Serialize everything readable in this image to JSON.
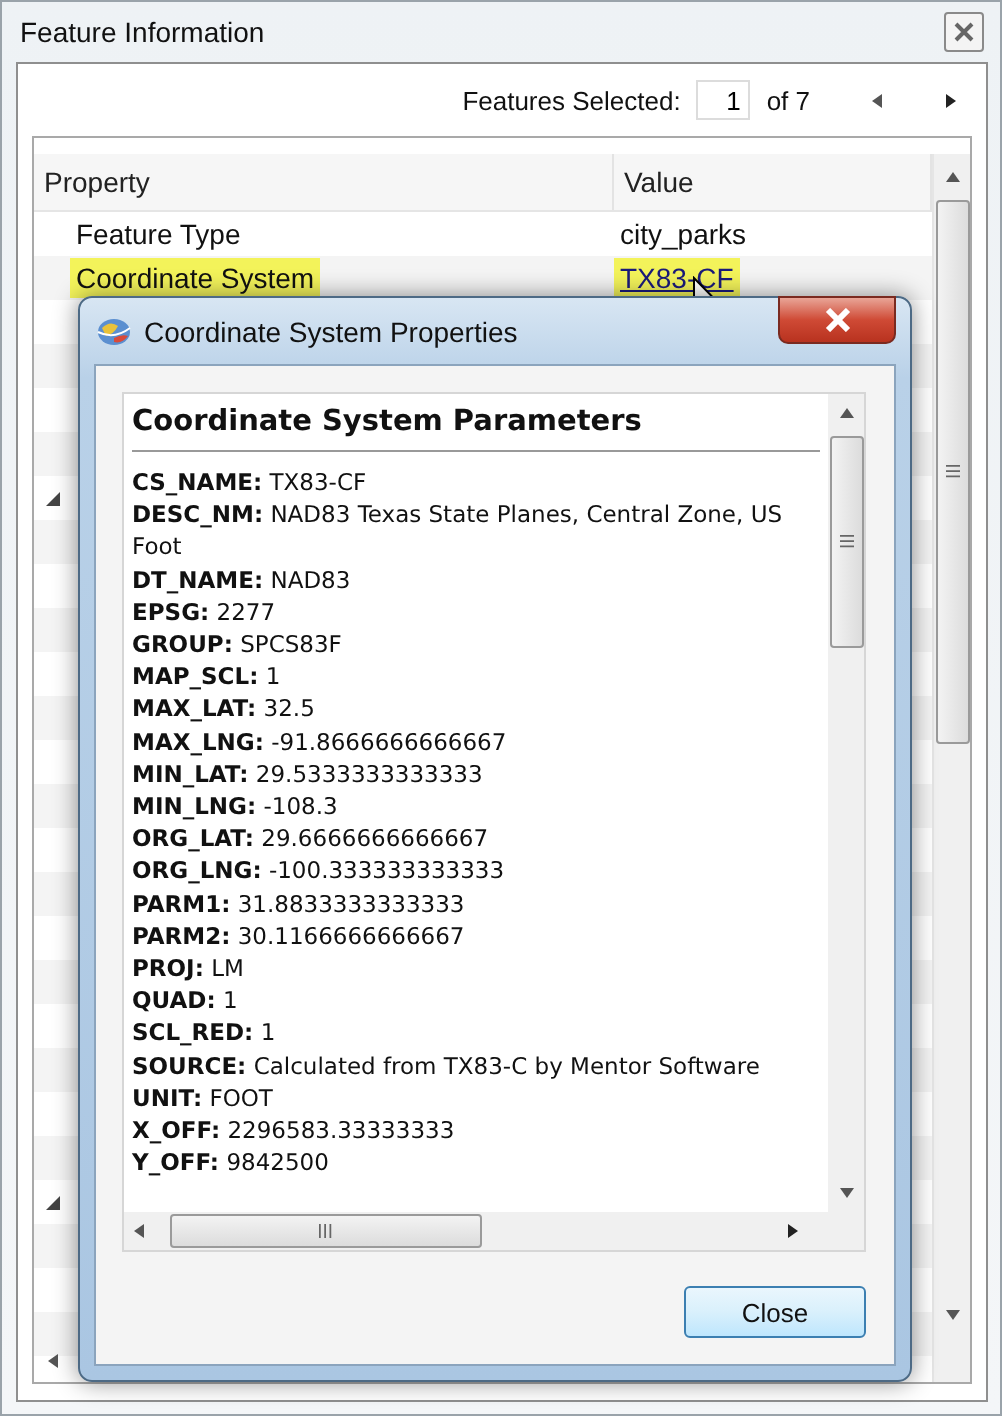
{
  "window": {
    "title": "Feature Information"
  },
  "toolbar": {
    "label": "Features Selected:",
    "value": "1",
    "total": "of 7"
  },
  "table": {
    "columns": [
      "Property",
      "Value"
    ],
    "rows": [
      {
        "property": "Feature Type",
        "value": "city_parks",
        "kind": "text",
        "selected": false
      },
      {
        "property": "Coordinate System",
        "value": "TX83-CF",
        "kind": "link",
        "selected": true
      }
    ],
    "groups": [
      {
        "expanded": true
      },
      {
        "expanded": true
      }
    ]
  },
  "dialog": {
    "title": "Coordinate System Properties",
    "heading": "Coordinate System Parameters",
    "params": [
      {
        "key": "CS_NAME:",
        "value": "TX83-CF"
      },
      {
        "key": "DESC_NM:",
        "value": "NAD83 Texas State Planes, Central Zone, US Foot"
      },
      {
        "key": "DT_NAME:",
        "value": "NAD83"
      },
      {
        "key": "EPSG:",
        "value": "2277"
      },
      {
        "key": "GROUP:",
        "value": "SPCS83F"
      },
      {
        "key": "MAP_SCL:",
        "value": "1"
      },
      {
        "key": "MAX_LAT:",
        "value": "32.5"
      },
      {
        "key": "MAX_LNG:",
        "value": "-91.8666666666667"
      },
      {
        "key": "MIN_LAT:",
        "value": "29.5333333333333"
      },
      {
        "key": "MIN_LNG:",
        "value": "-108.3"
      },
      {
        "key": "ORG_LAT:",
        "value": "29.6666666666667"
      },
      {
        "key": "ORG_LNG:",
        "value": "-100.333333333333"
      },
      {
        "key": "PARM1:",
        "value": "31.8833333333333"
      },
      {
        "key": "PARM2:",
        "value": "30.1166666666667"
      },
      {
        "key": "PROJ:",
        "value": "LM"
      },
      {
        "key": "QUAD:",
        "value": "1"
      },
      {
        "key": "SCL_RED:",
        "value": "1"
      },
      {
        "key": "SOURCE:",
        "value": "Calculated from TX83-C by Mentor Software"
      },
      {
        "key": "UNIT:",
        "value": "FOOT"
      },
      {
        "key": "X_OFF:",
        "value": "2296583.33333333"
      },
      {
        "key": "Y_OFF:",
        "value": "9842500"
      }
    ],
    "button": "Close"
  }
}
